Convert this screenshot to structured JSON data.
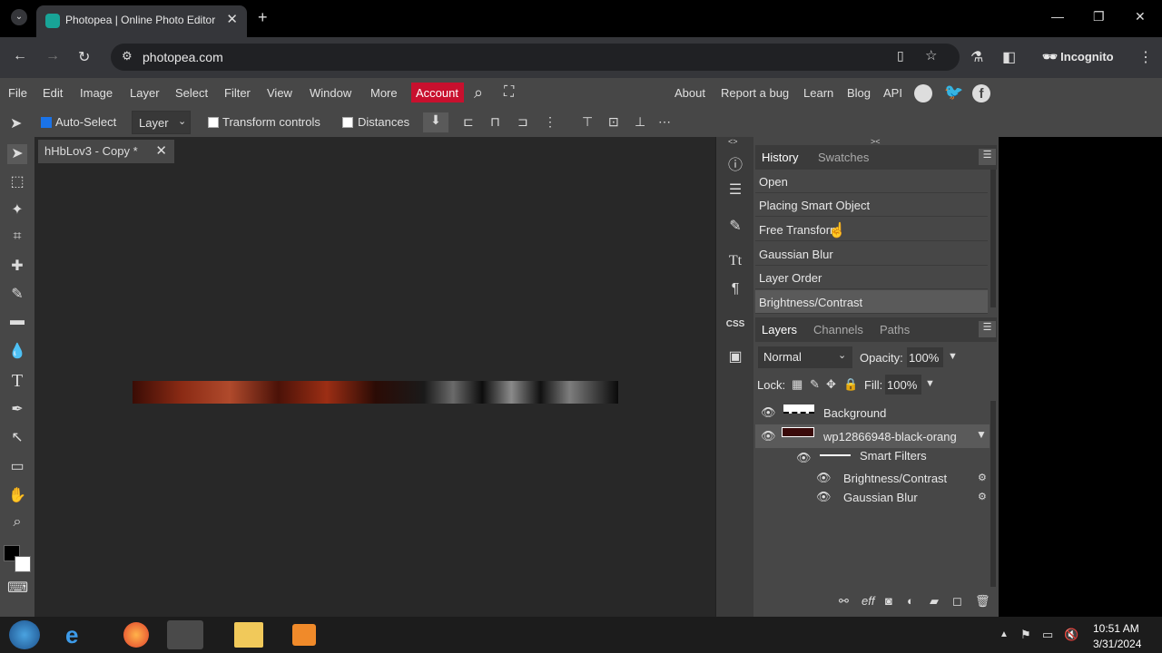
{
  "browser": {
    "tab_title": "Photopea | Online Photo Editor",
    "url": "photopea.com",
    "profile": "Incognito"
  },
  "menu": [
    "File",
    "Edit",
    "Image",
    "Layer",
    "Select",
    "Filter",
    "View",
    "Window",
    "More"
  ],
  "account_label": "Account",
  "right_links": [
    "About",
    "Report a bug",
    "Learn",
    "Blog",
    "API"
  ],
  "options": {
    "auto_select": "Auto-Select",
    "layer_select": "Layer",
    "transform_controls": "Transform controls",
    "distances": "Distances"
  },
  "document": {
    "tab_title": "hHbLov3 - Copy",
    "modified_mark": "*"
  },
  "history_panel": {
    "tabs": [
      "History",
      "Swatches"
    ],
    "items": [
      "Open",
      "Placing Smart Object",
      "Free Transform",
      "Gaussian Blur",
      "Layer Order",
      "Brightness/Contrast"
    ]
  },
  "layers_panel": {
    "tabs": [
      "Layers",
      "Channels",
      "Paths"
    ],
    "blend_mode": "Normal",
    "opacity_label": "Opacity:",
    "opacity": "100%",
    "lock_label": "Lock:",
    "fill_label": "Fill:",
    "fill": "100%",
    "layers": [
      "Background",
      "wp12866948-black-orang"
    ],
    "smart_filters_label": "Smart Filters",
    "filters": [
      "Brightness/Contrast",
      "Gaussian Blur"
    ]
  },
  "clock": {
    "time": "10:51 AM",
    "date": "3/31/2024"
  },
  "colors": {
    "accent_red": "#c8102e",
    "panel_bg": "#474747",
    "canvas_bg": "#282828"
  }
}
